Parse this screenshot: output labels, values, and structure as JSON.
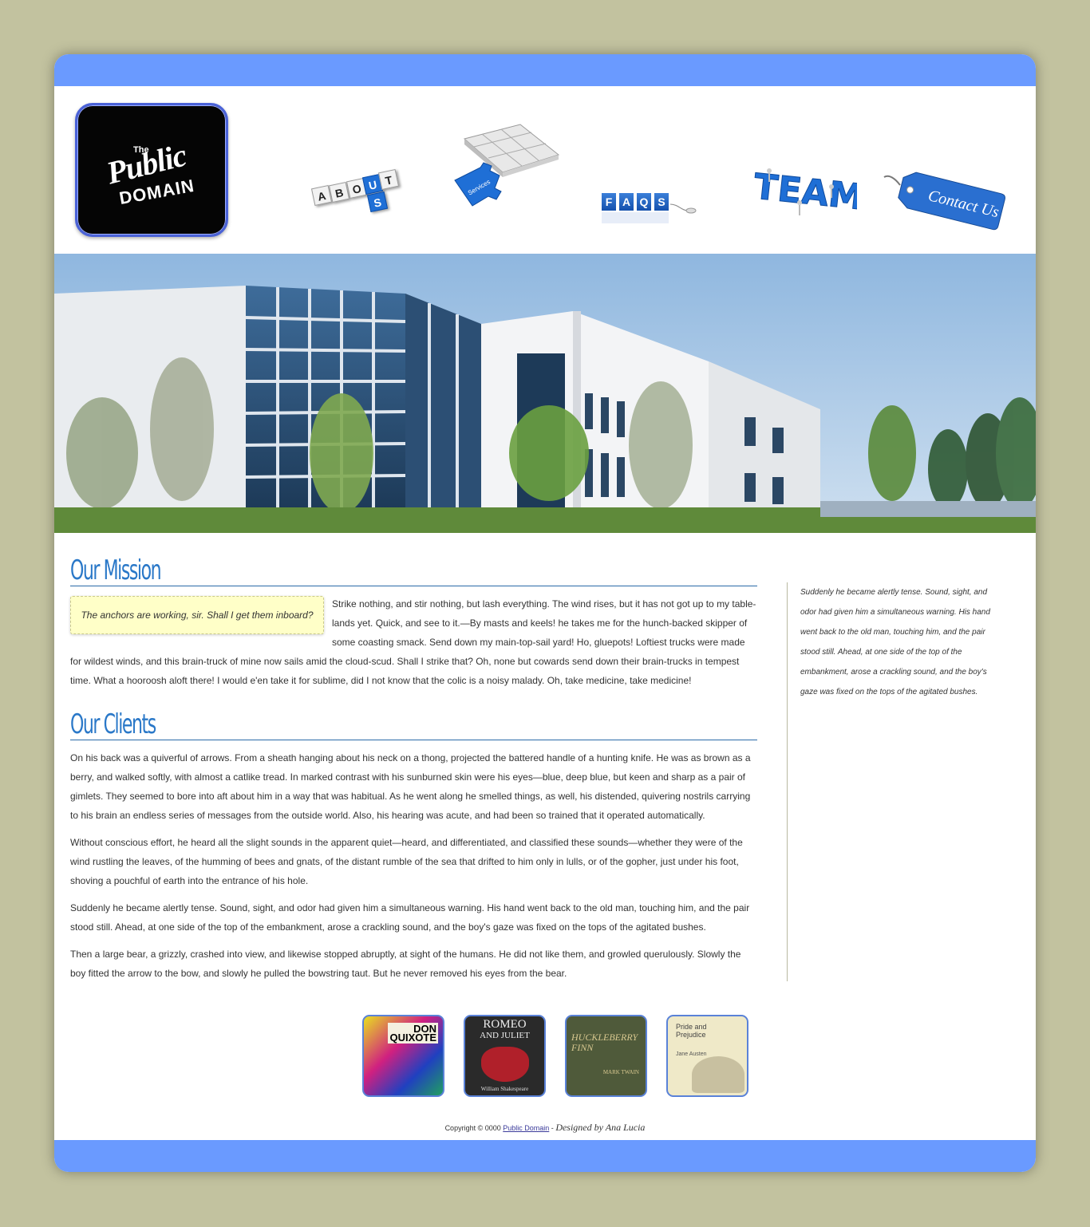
{
  "logo": {
    "the": "The",
    "public": "Public",
    "domain": "DOMAIN"
  },
  "nav": {
    "about": {
      "top": "ABOUT",
      "bottom": "S",
      "letters": [
        "A",
        "B",
        "O",
        "U",
        "T"
      ],
      "us": "U"
    },
    "services": {
      "label": "Services"
    },
    "faqs": {
      "letters": [
        "F",
        "A",
        "Q",
        "S"
      ]
    },
    "team": {
      "label": "TEAM"
    },
    "contact": {
      "label": "Contact Us"
    }
  },
  "mission": {
    "heading": "Our Mission",
    "quote": "The anchors are working, sir. Shall I get them inboard?",
    "text": "Strike nothing, and stir nothing, but lash everything. The wind rises, but it has not got up to my table-lands yet. Quick, and see to it.—By masts and keels! he takes me for the hunch-backed skipper of some coasting smack. Send down my main-top-sail yard! Ho, gluepots! Loftiest trucks were made for wildest winds, and this brain-truck of mine now sails amid the cloud-scud. Shall I strike that? Oh, none but cowards send down their brain-trucks in tempest time. What a hooroosh aloft there! I would e'en take it for sublime, did I not know that the colic is a noisy malady. Oh, take medicine, take medicine!"
  },
  "clients": {
    "heading": "Our Clients",
    "paragraphs": [
      "On his back was a quiverful of arrows. From a sheath hanging about his neck on a thong, projected the battered handle of a hunting knife. He was as brown as a berry, and walked softly, with almost a catlike tread. In marked contrast with his sunburned skin were his eyes—blue, deep blue, but keen and sharp as a pair of gimlets. They seemed to bore into aft about him in a way that was habitual. As he went along he smelled things, as well, his distended, quivering nostrils carrying to his brain an endless series of messages from the outside world. Also, his hearing was acute, and had been so trained that it operated automatically.",
      "Without conscious effort, he heard all the slight sounds in the apparent quiet—heard, and differentiated, and classified these sounds—whether they were of the wind rustling the leaves, of the humming of bees and gnats, of the distant rumble of the sea that drifted to him only in lulls, or of the gopher, just under his foot, shoving a pouchful of earth into the entrance of his hole.",
      "Suddenly he became alertly tense. Sound, sight, and odor had given him a simultaneous warning. His hand went back to the old man, touching him, and the pair stood still. Ahead, at one side of the top of the embankment, arose a crackling sound, and the boy's gaze was fixed on the tops of the agitated bushes.",
      "Then a large bear, a grizzly, crashed into view, and likewise stopped abruptly, at sight of the humans. He did not like them, and growled querulously. Slowly the boy fitted the arrow to the bow, and slowly he pulled the bowstring taut. But he never removed his eyes from the bear."
    ]
  },
  "sidebar": {
    "text": "Suddenly he became alertly tense. Sound, sight, and odor had given him a simultaneous warning. His hand went back to the old man, touching him, and the pair stood still. Ahead, at one side of the top of the embankment, arose a crackling sound, and the boy's gaze was fixed on the tops of the agitated bushes."
  },
  "books": [
    {
      "title_1": "DON",
      "title_2": "QUIXOTE",
      "author": ""
    },
    {
      "title_1": "ROMEO",
      "title_2": "AND JULIET",
      "author": "William Shakespeare"
    },
    {
      "title_1": "HUCKLEBERRY",
      "title_2": "FINN",
      "author": "MARK TWAIN"
    },
    {
      "title_1": "Pride and Prejudice",
      "title_2": "",
      "author": "Jane Austen"
    }
  ],
  "footer": {
    "copyright": "Copyright © 0000",
    "link": "Public Domain",
    "separator": "-",
    "designed": "Designed by Ana Lucia"
  },
  "colors": {
    "band": "#6a9aff",
    "page_bg": "#c2c29f",
    "heading": "#2a78c8",
    "quote_bg": "#ffffc8"
  }
}
